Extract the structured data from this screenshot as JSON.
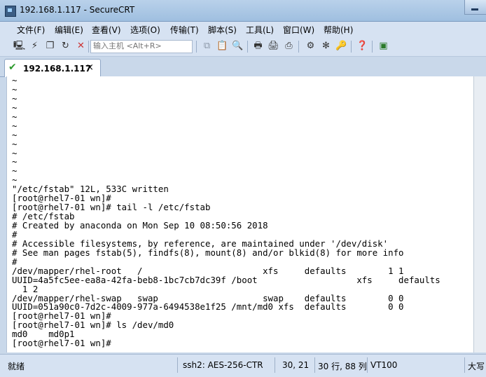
{
  "window": {
    "title": "192.168.1.117 - SecureCRT"
  },
  "menu": [
    "文件(F)",
    "编辑(E)",
    "查看(V)",
    "选项(O)",
    "传输(T)",
    "脚本(S)",
    "工具(L)",
    "窗口(W)",
    "帮助(H)"
  ],
  "toolbar": {
    "host_placeholder": "输入主机 <Alt+R>"
  },
  "tab": {
    "label": "192.168.1.117",
    "close": "×"
  },
  "terminal": {
    "lines": [
      "~",
      "~",
      "~",
      "~",
      "~",
      "~",
      "~",
      "~",
      "~",
      "~",
      "~",
      "~",
      "\"/etc/fstab\" 12L, 533C written",
      "[root@rhel7-01 wn]#",
      "[root@rhel7-01 wn]# tail -l /etc/fstab",
      "# /etc/fstab",
      "# Created by anaconda on Mon Sep 10 08:50:56 2018",
      "#",
      "# Accessible filesystems, by reference, are maintained under '/dev/disk'",
      "# See man pages fstab(5), findfs(8), mount(8) and/or blkid(8) for more info",
      "#",
      "/dev/mapper/rhel-root   /                       xfs     defaults        1 1",
      "UUID=4a5fc5ee-ea8a-42fa-beb8-1bc7cb7dc39f /boot                   xfs     defaults",
      "  1 2",
      "/dev/mapper/rhel-swap   swap                    swap    defaults        0 0",
      "UUID=051a90c0-7d2c-4009-977a-6494538e1f25 /mnt/md0 xfs  defaults        0 0",
      "[root@rhel7-01 wn]#",
      "[root@rhel7-01 wn]# ls /dev/md0",
      "md0    md0p1",
      "[root@rhel7-01 wn]# "
    ]
  },
  "status": {
    "ready": "就绪",
    "cipher": "ssh2: AES-256-CTR",
    "cursor": "30,  21",
    "size": "30 行, 88 列",
    "emulation": "VT100",
    "caps": "大写"
  }
}
